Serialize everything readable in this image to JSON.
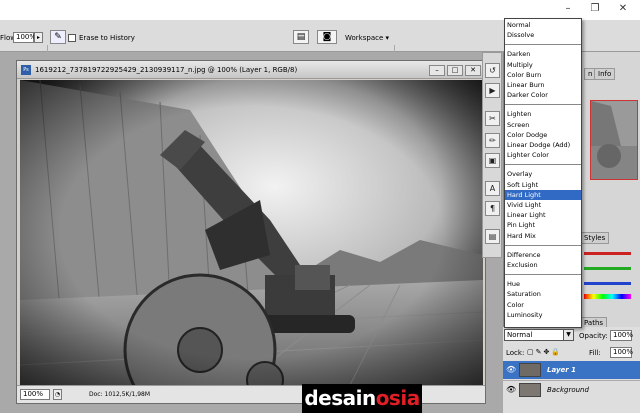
{
  "options_bar": {
    "flow_label": "Flow:",
    "flow_value": "100%",
    "erase_to_history_label": "Erase to History",
    "workspace_label": "Workspace"
  },
  "document": {
    "title": "1619212_737819722925429_2130939117_n.jpg @ 100% (Layer 1, RGB/8)",
    "zoom": "100%",
    "doc_info": "Doc: 1012,5K/1,98M",
    "icon_label": "Ps"
  },
  "blend_menu": {
    "groups": [
      [
        "Normal",
        "Dissolve"
      ],
      [
        "Darken",
        "Multiply",
        "Color Burn",
        "Linear Burn",
        "Darker Color"
      ],
      [
        "Lighten",
        "Screen",
        "Color Dodge",
        "Linear Dodge (Add)",
        "Lighter Color"
      ],
      [
        "Overlay",
        "Soft Light",
        "Hard Light",
        "Vivid Light",
        "Linear Light",
        "Pin Light",
        "Hard Mix"
      ],
      [
        "Difference",
        "Exclusion"
      ],
      [
        "Hue",
        "Saturation",
        "Color",
        "Luminosity"
      ]
    ],
    "selected": "Hard Light",
    "current_value": "Normal"
  },
  "panels": {
    "tab_n": "n",
    "tab_info": "Info",
    "tab_styles": "Styles",
    "tab_paths": "Paths"
  },
  "layers": {
    "opacity_label": "Opacity:",
    "opacity_value": "100%",
    "lock_label": "Lock:",
    "fill_label": "Fill:",
    "fill_value": "100%",
    "items": [
      {
        "name": "Layer 1",
        "selected": true
      },
      {
        "name": "Background",
        "selected": false
      }
    ]
  },
  "watermark": {
    "part1": "desain",
    "part2": "osia"
  },
  "colors": {
    "selection": "#316ac5",
    "layer_selected": "#3a72c4",
    "watermark_accent": "#e01e26"
  }
}
